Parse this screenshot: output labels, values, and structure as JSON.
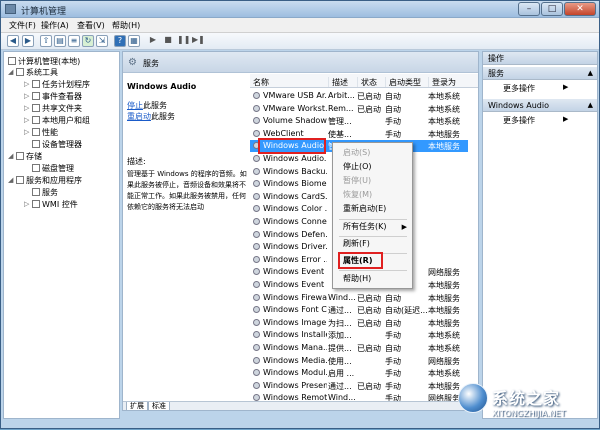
{
  "window": {
    "title": "计算机管理"
  },
  "menu": [
    "文件(F)",
    "操作(A)",
    "查看(V)",
    "帮助(H)"
  ],
  "tree": [
    {
      "label": "计算机管理(本地)",
      "icon": "computer-icon"
    },
    {
      "label": "系统工具",
      "icon": "tools-icon"
    },
    {
      "label": "任务计划程序",
      "icon": "clock-icon"
    },
    {
      "label": "事件查看器",
      "icon": "event-icon"
    },
    {
      "label": "共享文件夹",
      "icon": "folder-icon"
    },
    {
      "label": "本地用户和组",
      "icon": "users-icon"
    },
    {
      "label": "性能",
      "icon": "performance-icon"
    },
    {
      "label": "设备管理器",
      "icon": "device-icon"
    },
    {
      "label": "存储",
      "icon": "storage-icon"
    },
    {
      "label": "磁盘管理",
      "icon": "disk-icon"
    },
    {
      "label": "服务和应用程序",
      "icon": "services-apps-icon"
    },
    {
      "label": "服务",
      "icon": "gear-icon"
    },
    {
      "label": "WMI 控件",
      "icon": "wmi-icon"
    }
  ],
  "center": {
    "header": "服务",
    "selected_name": "Windows Audio",
    "stop_link": "停止",
    "stop_rest": "此服务",
    "restart_link": "重启动",
    "restart_rest": "此服务",
    "desc_label": "描述:",
    "desc_text": "管理基于 Windows 的程序的音频。如果此服务被停止，音频设备和效果将不能正常工作。如果此服务被禁用，任何依赖它的服务将无法启动"
  },
  "columns": [
    "名称",
    "描述",
    "状态",
    "启动类型",
    "登录为"
  ],
  "rows": [
    [
      "VMware USB Ar...",
      "Arbit...",
      "已启动",
      "自动",
      "本地系统"
    ],
    [
      "VMware Workst...",
      "Rem...",
      "已启动",
      "自动",
      "本地系统"
    ],
    [
      "Volume Shadow...",
      "管理...",
      "",
      "手动",
      "本地系统"
    ],
    [
      "WebClient",
      "使基...",
      "",
      "手动",
      "本地服务"
    ],
    [
      "Windows Audio",
      "管理...",
      "已启动",
      "自动",
      "本地服务"
    ],
    [
      "Windows Audio...",
      "",
      "",
      "",
      ""
    ],
    [
      "Windows Backu...",
      "",
      "",
      "",
      ""
    ],
    [
      "Windows Biome...",
      "",
      "",
      "",
      ""
    ],
    [
      "Windows CardS...",
      "",
      "",
      "",
      ""
    ],
    [
      "Windows Color ...",
      "",
      "",
      "",
      ""
    ],
    [
      "Windows Conne...",
      "",
      "",
      "",
      ""
    ],
    [
      "Windows Defen...",
      "",
      "",
      "",
      ""
    ],
    [
      "Windows Driver...",
      "",
      "",
      "",
      ""
    ],
    [
      "Windows Error ...",
      "",
      "",
      "",
      ""
    ],
    [
      "Windows Event ...",
      "",
      "",
      "",
      "网络服务"
    ],
    [
      "Windows Event ...",
      "",
      "",
      "",
      "本地服务"
    ],
    [
      "Windows Firewall",
      "Wind...",
      "已启动",
      "自动",
      "本地服务"
    ],
    [
      "Windows Font C...",
      "通过...",
      "已启动",
      "自动(延迟...",
      "本地服务"
    ],
    [
      "Windows Image...",
      "为扫...",
      "已启动",
      "自动",
      "本地服务"
    ],
    [
      "Windows Installer",
      "添加...",
      "",
      "手动",
      "本地系统"
    ],
    [
      "Windows Mana...",
      "提供...",
      "已启动",
      "自动",
      "本地系统"
    ],
    [
      "Windows Media...",
      "使用...",
      "",
      "手动",
      "网络服务"
    ],
    [
      "Windows Modul...",
      "启用 ...",
      "",
      "手动",
      "本地系统"
    ],
    [
      "Windows Presen...",
      "通过...",
      "已启动",
      "手动",
      "本地服务"
    ],
    [
      "Windows Remot...",
      "Wind...",
      "",
      "手动",
      "网络服务"
    ]
  ],
  "tabs": [
    "扩展",
    "标准"
  ],
  "context_menu": {
    "items": [
      {
        "label": "启动(S)",
        "disabled": true
      },
      {
        "label": "停止(O)",
        "disabled": false
      },
      {
        "label": "暂停(U)",
        "disabled": true
      },
      {
        "label": "恢复(M)",
        "disabled": true
      },
      {
        "label": "重新启动(E)",
        "disabled": false
      },
      {
        "label": "所有任务(K)",
        "disabled": false
      },
      {
        "label": "刷新(F)",
        "disabled": false
      },
      {
        "label": "属性(R)",
        "disabled": false
      },
      {
        "label": "帮助(H)",
        "disabled": false
      }
    ]
  },
  "actions": {
    "header": "操作",
    "section1": "服务",
    "more1": "更多操作",
    "section2": "Windows Audio",
    "more2": "更多操作"
  },
  "watermark": {
    "text": "系统之家",
    "sub": "XITONGZHIJIA.NET"
  },
  "colors": {
    "selection": "#3399ff",
    "highlight_box": "#e02020",
    "link": "#1a5bc9"
  }
}
